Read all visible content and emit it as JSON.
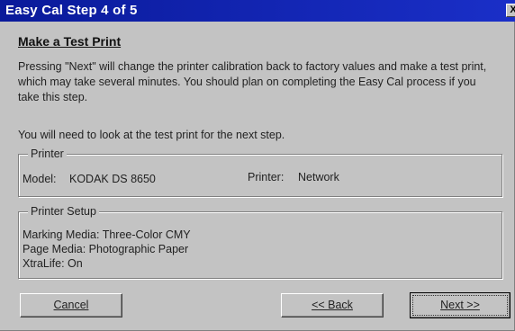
{
  "window": {
    "title": "Easy Cal Step 4 of 5",
    "close_glyph": "X"
  },
  "heading": "Make a Test Print",
  "paragraph1": "Pressing \"Next\" will change the printer calibration back to factory values and make a test print, which may take several minutes. You should plan on completing the Easy Cal process if you take this step.",
  "paragraph2": "You will need to look at the test print for the next step.",
  "printer_group": {
    "legend": "Printer",
    "model_label": "Model:",
    "model_value": "KODAK DS 8650",
    "printer_label": "Printer:",
    "printer_value": "Network"
  },
  "setup_group": {
    "legend": "Printer Setup",
    "marking_media": "Marking Media: Three-Color CMY",
    "page_media": "Page Media: Photographic Paper",
    "xtralife": "XtraLife: On"
  },
  "buttons": {
    "cancel": "Cancel",
    "back": "<< Back",
    "next": "Next >>"
  }
}
